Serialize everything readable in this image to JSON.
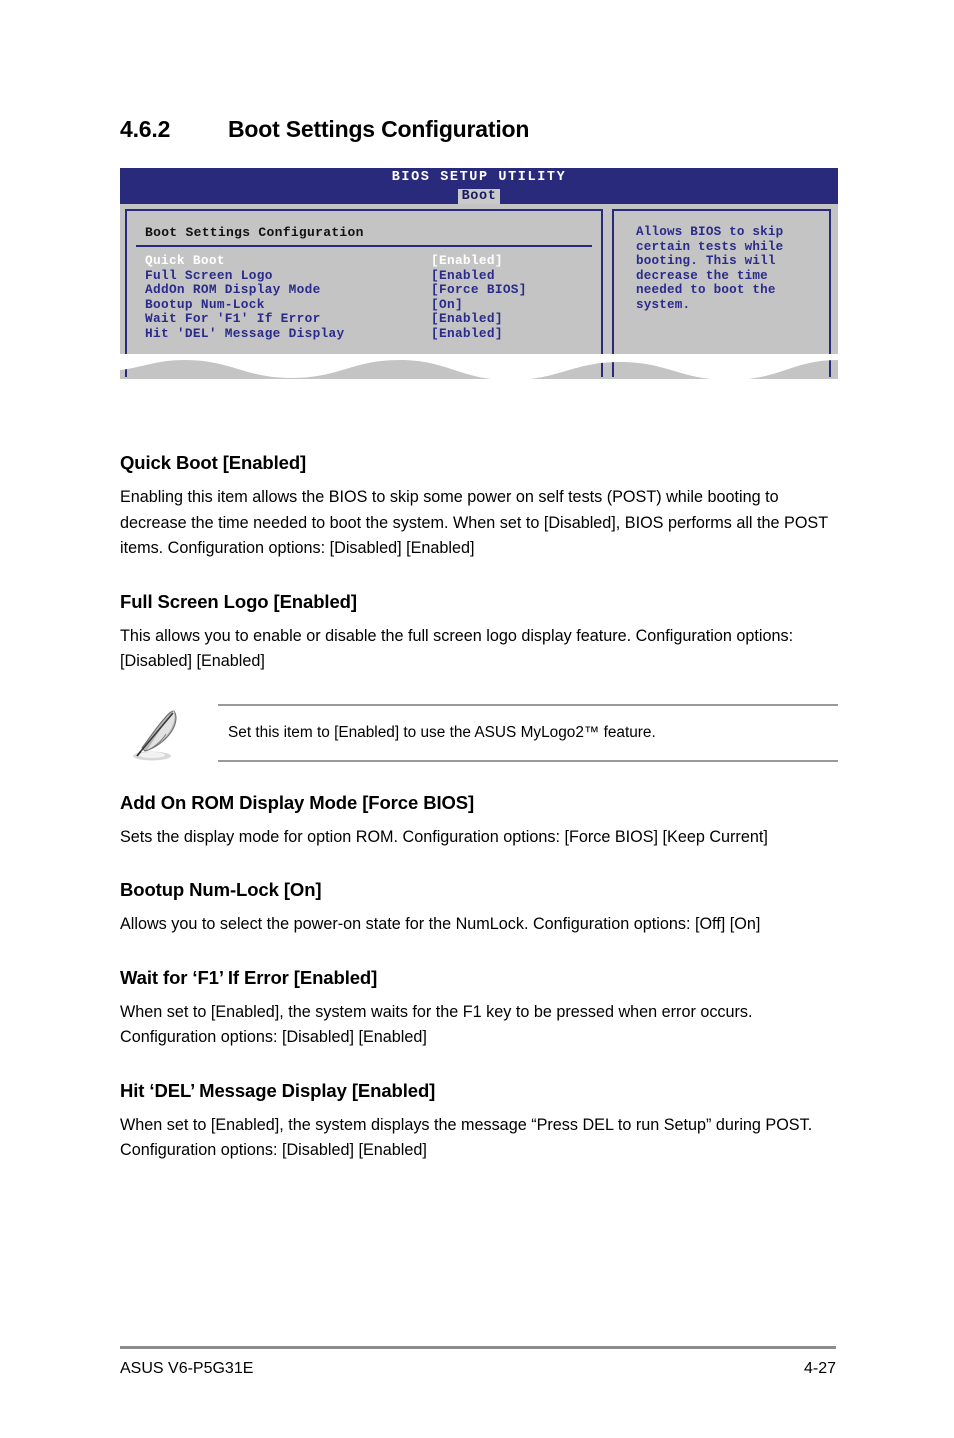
{
  "section": {
    "number": "4.6.2",
    "title": "Boot Settings Configuration"
  },
  "bios": {
    "utility_title": "BIOS SETUP UTILITY",
    "active_tab": "Boot",
    "panel_title": "Boot Settings Configuration",
    "items": [
      {
        "label": "Quick Boot",
        "value": "[Enabled]",
        "selected": true
      },
      {
        "label": "Full Screen Logo",
        "value": "[Enabled",
        "selected": false
      },
      {
        "label": "AddOn ROM Display Mode",
        "value": "[Force BIOS]",
        "selected": false
      },
      {
        "label": "Bootup Num-Lock",
        "value": "[On]",
        "selected": false
      },
      {
        "label": "Wait For 'F1' If Error",
        "value": "[Enabled]",
        "selected": false
      },
      {
        "label": "Hit 'DEL' Message Display",
        "value": "[Enabled]",
        "selected": false
      }
    ],
    "help_text": "Allows BIOS to skip\ncertain tests while\nbooting. This will\ndecrease the time\nneeded to boot the\nsystem.",
    "colors": {
      "header_blue": "#2a2a7c",
      "body_gray": "#c4c4c4",
      "item_blue": "#2a2a8c",
      "selected_white": "#ffffff"
    }
  },
  "content": {
    "quick_boot": {
      "heading": "Quick Boot [Enabled]",
      "body": "Enabling this item allows the BIOS to skip some power on self tests (POST) while booting to decrease the time needed to boot the system. When set to [Disabled], BIOS performs all the POST items. Configuration options: [Disabled] [Enabled]"
    },
    "full_screen_logo": {
      "heading": "Full Screen Logo [Enabled]",
      "body": "This allows you to enable or disable the full screen logo display feature. Configuration options: [Disabled] [Enabled]"
    },
    "note": {
      "icon": "pencil-note-icon",
      "text": "Set this item to [Enabled] to use the ASUS MyLogo2™ feature."
    },
    "add_on_rom": {
      "heading": "Add On ROM Display Mode [Force BIOS]",
      "body": "Sets the display mode for option ROM. Configuration options: [Force BIOS] [Keep Current]"
    },
    "bootup_numlock": {
      "heading": "Bootup Num-Lock [On]",
      "body": "Allows you to select the power-on state for the NumLock. Configuration options: [Off] [On]"
    },
    "wait_f1": {
      "heading": "Wait for ‘F1’ If Error [Enabled]",
      "body": "When set to [Enabled], the system waits for the F1 key to be pressed when error occurs. Configuration options: [Disabled] [Enabled]"
    },
    "hit_del": {
      "heading": "Hit ‘DEL’ Message Display [Enabled]",
      "body": "When set to [Enabled], the system displays the message “Press DEL to run Setup” during POST. Configuration options: [Disabled] [Enabled]"
    }
  },
  "footer": {
    "product": "ASUS V6-P5G31E",
    "page_number": "4-27"
  }
}
